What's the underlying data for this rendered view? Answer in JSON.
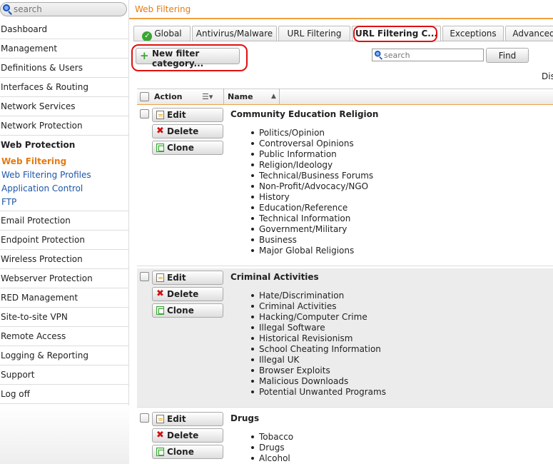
{
  "sidebar": {
    "search_placeholder": "search",
    "items": [
      {
        "label": "Dashboard"
      },
      {
        "label": "Management"
      },
      {
        "label": "Definitions & Users"
      },
      {
        "label": "Interfaces & Routing"
      },
      {
        "label": "Network Services"
      },
      {
        "label": "Network Protection"
      },
      {
        "label": "Web Protection"
      }
    ],
    "subitems": [
      {
        "label": "Web Filtering"
      },
      {
        "label": "Web Filtering Profiles"
      },
      {
        "label": "Application Control"
      },
      {
        "label": "FTP"
      }
    ],
    "items_after": [
      {
        "label": "Email Protection"
      },
      {
        "label": "Endpoint Protection"
      },
      {
        "label": "Wireless Protection"
      },
      {
        "label": "Webserver Protection"
      },
      {
        "label": "RED Management"
      },
      {
        "label": "Site-to-site VPN"
      },
      {
        "label": "Remote Access"
      },
      {
        "label": "Logging & Reporting"
      },
      {
        "label": "Support"
      },
      {
        "label": "Log off"
      }
    ]
  },
  "header": {
    "title": "Web Filtering"
  },
  "tabs": [
    {
      "label": "Global"
    },
    {
      "label": "Antivirus/Malware"
    },
    {
      "label": "URL Filtering"
    },
    {
      "label": "URL Filtering C..."
    },
    {
      "label": "Exceptions"
    },
    {
      "label": "Advanced"
    }
  ],
  "toolbar": {
    "new_label": "New filter category...",
    "search_placeholder": "search",
    "find_label": "Find",
    "display_label": "Dis"
  },
  "table": {
    "col_action": "Action",
    "col_name": "Name",
    "btn_edit": "Edit",
    "btn_delete": "Delete",
    "btn_clone": "Clone",
    "rows": [
      {
        "name": "Community Education Religion",
        "items": [
          "Politics/Opinion",
          "Controversal Opinions",
          "Public Information",
          "Religion/Ideology",
          "Technical/Business Forums",
          "Non-Profit/Advocacy/NGO",
          "History",
          "Education/Reference",
          "Technical Information",
          "Government/Military",
          "Business",
          "Major Global Religions"
        ]
      },
      {
        "name": "Criminal Activities",
        "items": [
          "Hate/Discrimination",
          "Criminal Activities",
          "Hacking/Computer Crime",
          "Illegal Software",
          "Historical Revisionism",
          "School Cheating Information",
          "Illegal UK",
          "Browser Exploits",
          "Malicious Downloads",
          "Potential Unwanted Programs"
        ]
      },
      {
        "name": "Drugs",
        "items": [
          "Tobacco",
          "Drugs",
          "Alcohol"
        ]
      }
    ]
  },
  "colors": {
    "accent": "#e47b12",
    "link": "#1b56a6",
    "highlight": "#e01010"
  }
}
